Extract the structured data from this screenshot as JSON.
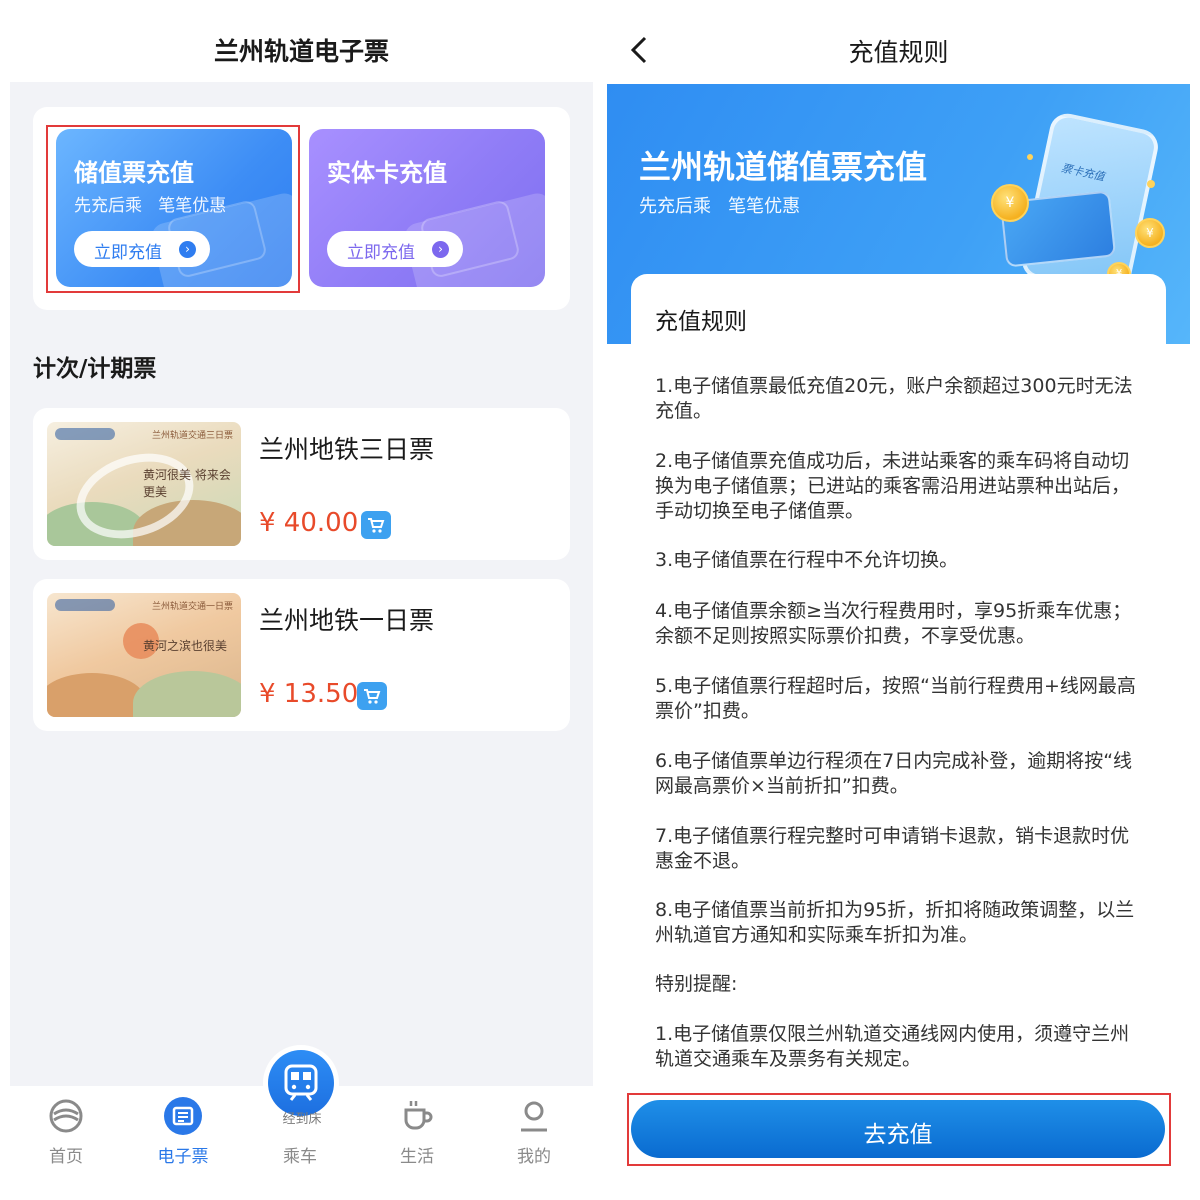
{
  "left_screen": {
    "header": {
      "title": "兰州轨道电子票"
    },
    "recharge_cards": [
      {
        "title": "储值票充值",
        "subtitle": "先充后乘   笔笔优惠",
        "button_label": "立即充值",
        "color": "#3d8df5"
      },
      {
        "title": "实体卡充值",
        "button_label": "立即充值",
        "color": "#8f7cf6"
      }
    ],
    "section_title": "计次/计期票",
    "products": [
      {
        "name": "兰州地铁三日票",
        "price": "¥ 40.00",
        "image_title": "兰州轨道交通三日票",
        "image_text": "黄河很美 将来会更美"
      },
      {
        "name": "兰州地铁一日票",
        "price": "¥ 13.50",
        "image_title": "兰州轨道交通一日票",
        "image_text": "黄河之滨也很美"
      }
    ],
    "bottom_nav": {
      "items": [
        {
          "label": "首页",
          "icon": "home-icon"
        },
        {
          "label": "电子票",
          "icon": "ticket-icon",
          "active": true
        },
        {
          "label": "乘车",
          "icon": "metro-icon"
        },
        {
          "label": "生活",
          "icon": "coffee-icon"
        },
        {
          "label": "我的",
          "icon": "user-icon"
        }
      ],
      "fab_text": "经到床",
      "active_color": "#2a78e8"
    }
  },
  "right_screen": {
    "header": {
      "title": "充值规则",
      "back_icon": "chevron-left-icon"
    },
    "banner": {
      "title": "兰州轨道储值票充值",
      "subtitle": "先充后乘   笔笔优惠",
      "phone_label": "票卡充值",
      "coin_symbol": "¥"
    },
    "rules": {
      "title": "充值规则",
      "items": [
        "1.电子储值票最低充值20元，账户余额超过300元时无法充值。",
        "2.电子储值票充值成功后，未进站乘客的乘车码将自动切换为电子储值票；已进站的乘客需沿用进站票种出站后，手动切换至电子储值票。",
        "3.电子储值票在行程中不允许切换。",
        "4.电子储值票余额≥当次行程费用时，享95折乘车优惠；余额不足则按照实际票价扣费，不享受优惠。",
        "5.电子储值票行程超时后，按照“当前行程费用+线网最高票价”扣费。",
        "6.电子储值票单边行程须在7日内完成补登，逾期将按“线网最高票价×当前折扣”扣费。",
        "7.电子储值票行程完整时可申请销卡退款，销卡退款时优惠金不退。",
        "8.电子储值票当前折扣为95折，折扣将随政策调整，以兰州轨道官方通知和实际乘车折扣为准。"
      ],
      "special_title": "特别提醒:",
      "special_items": [
        "1.电子储值票仅限兰州轨道交通线网内使用，须遵守兰州轨道交通乘车及票务有关规定。"
      ]
    },
    "cta": {
      "label": "去充值",
      "color": "#0a6bd0"
    }
  },
  "highlight_color": "#e23a3a"
}
